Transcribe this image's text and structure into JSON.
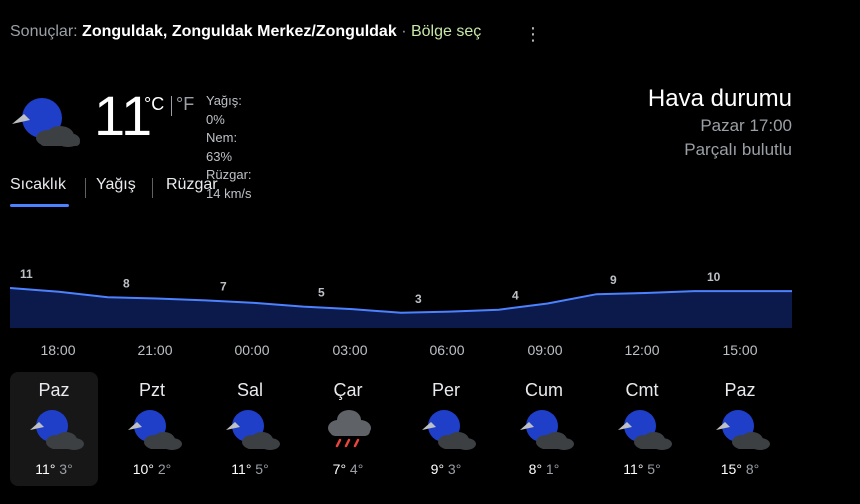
{
  "header": {
    "prefix": "Sonuçlar:",
    "location": "Zonguldak, Zonguldak Merkez/Zonguldak",
    "separator": "·",
    "region_link": "Bölge seç",
    "more_glyph": "⋮"
  },
  "current": {
    "icon": "partly-cloudy-night-icon",
    "temperature": "11",
    "unit_c": "°C",
    "unit_f": "°F",
    "precipitation": "Yağış: 0%",
    "humidity": "Nem: 63%",
    "wind": "Rüzgar: 14 km/s"
  },
  "summary": {
    "title": "Hava durumu",
    "time": "Pazar 17:00",
    "condition": "Parçalı bulutlu"
  },
  "tabs": [
    {
      "label": "Sıcaklık",
      "active": true
    },
    {
      "label": "Yağış",
      "active": false
    },
    {
      "label": "Rüzgar",
      "active": false
    }
  ],
  "chart_data": {
    "type": "area",
    "labels": [
      "11",
      "8",
      "7",
      "5",
      "3",
      "4",
      "9",
      "10"
    ],
    "series": [
      {
        "values": [
          11,
          8,
          7,
          5,
          3,
          4,
          9,
          10
        ]
      }
    ],
    "color": "#4c82ff"
  },
  "times": [
    "18:00",
    "21:00",
    "00:00",
    "03:00",
    "06:00",
    "09:00",
    "12:00",
    "15:00"
  ],
  "days": [
    {
      "name": "Paz",
      "icon": "partly-cloudy-night-icon",
      "high": "11°",
      "low": "3°",
      "selected": true
    },
    {
      "name": "Pzt",
      "icon": "partly-cloudy-night-icon",
      "high": "10°",
      "low": "2°",
      "selected": false
    },
    {
      "name": "Sal",
      "icon": "partly-cloudy-night-icon",
      "high": "11°",
      "low": "5°",
      "selected": false
    },
    {
      "name": "Çar",
      "icon": "rain-icon",
      "high": "7°",
      "low": "4°",
      "selected": false
    },
    {
      "name": "Per",
      "icon": "partly-cloudy-night-icon",
      "high": "9°",
      "low": "3°",
      "selected": false
    },
    {
      "name": "Cum",
      "icon": "partly-cloudy-night-icon",
      "high": "8°",
      "low": "1°",
      "selected": false
    },
    {
      "name": "Cmt",
      "icon": "partly-cloudy-night-icon",
      "high": "11°",
      "low": "5°",
      "selected": false
    },
    {
      "name": "Paz",
      "icon": "partly-cloudy-night-icon",
      "high": "15°",
      "low": "8°",
      "selected": false
    }
  ],
  "colors": {
    "accent": "#4c82ff",
    "moon": "#1f3fc9",
    "cloud": "#3c4043",
    "rain": "#e8453c"
  }
}
